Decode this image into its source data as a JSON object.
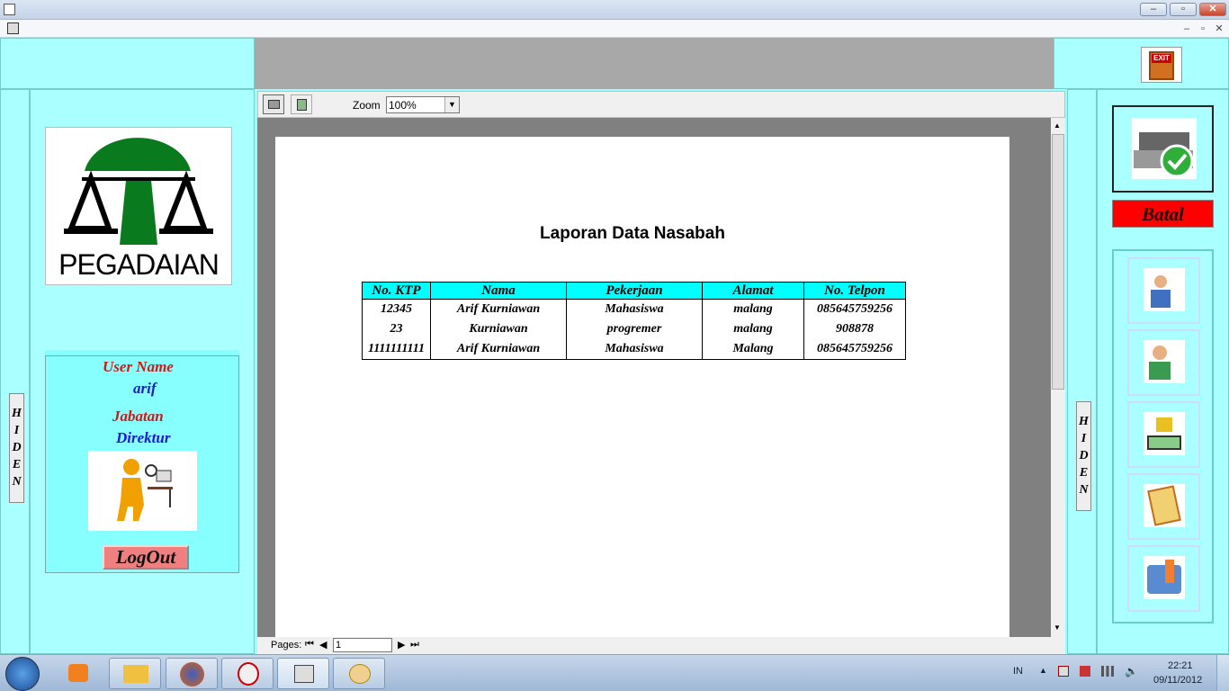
{
  "window": {
    "minimize": "–",
    "restore": "▫",
    "close": "✕",
    "inner_minimize": "–",
    "inner_restore": "▫",
    "inner_close": "✕"
  },
  "exit_label": "EXIT",
  "logo_text": "PEGADAIAN",
  "hiden_left": [
    "H",
    "I",
    "D",
    "E",
    "N"
  ],
  "hiden_right": [
    "H",
    "I",
    "D",
    "E",
    "N"
  ],
  "user": {
    "user_name_label": "User Name",
    "user_name": "arif",
    "jabatan_label": "Jabatan",
    "jabatan": "Direktur",
    "logout": "LogOut"
  },
  "viewer": {
    "zoom_label": "Zoom",
    "zoom_value": "100%",
    "pages_label": "Pages:",
    "page_number": "1"
  },
  "report": {
    "title": "Laporan Data Nasabah",
    "columns": [
      "No. KTP",
      "Nama",
      "Pekerjaan",
      "Alamat",
      "No. Telpon"
    ],
    "rows": [
      [
        "12345",
        "Arif Kurniawan",
        "Mahasiswa",
        "malang",
        "085645759256"
      ],
      [
        "23",
        "Kurniawan",
        "progremer",
        "malang",
        "908878"
      ],
      [
        "1111111111",
        "Arif Kurniawan",
        "Mahasiswa",
        "Malang",
        "085645759256"
      ]
    ]
  },
  "right_panel": {
    "batal": "Batal",
    "nav_icons": [
      "customer-data-icon",
      "customer-card-icon",
      "pawn-money-icon",
      "clipboard-icon",
      "settings-tools-icon"
    ]
  },
  "taskbar": {
    "language": "IN",
    "time": "22:21",
    "date": "09/11/2012"
  }
}
